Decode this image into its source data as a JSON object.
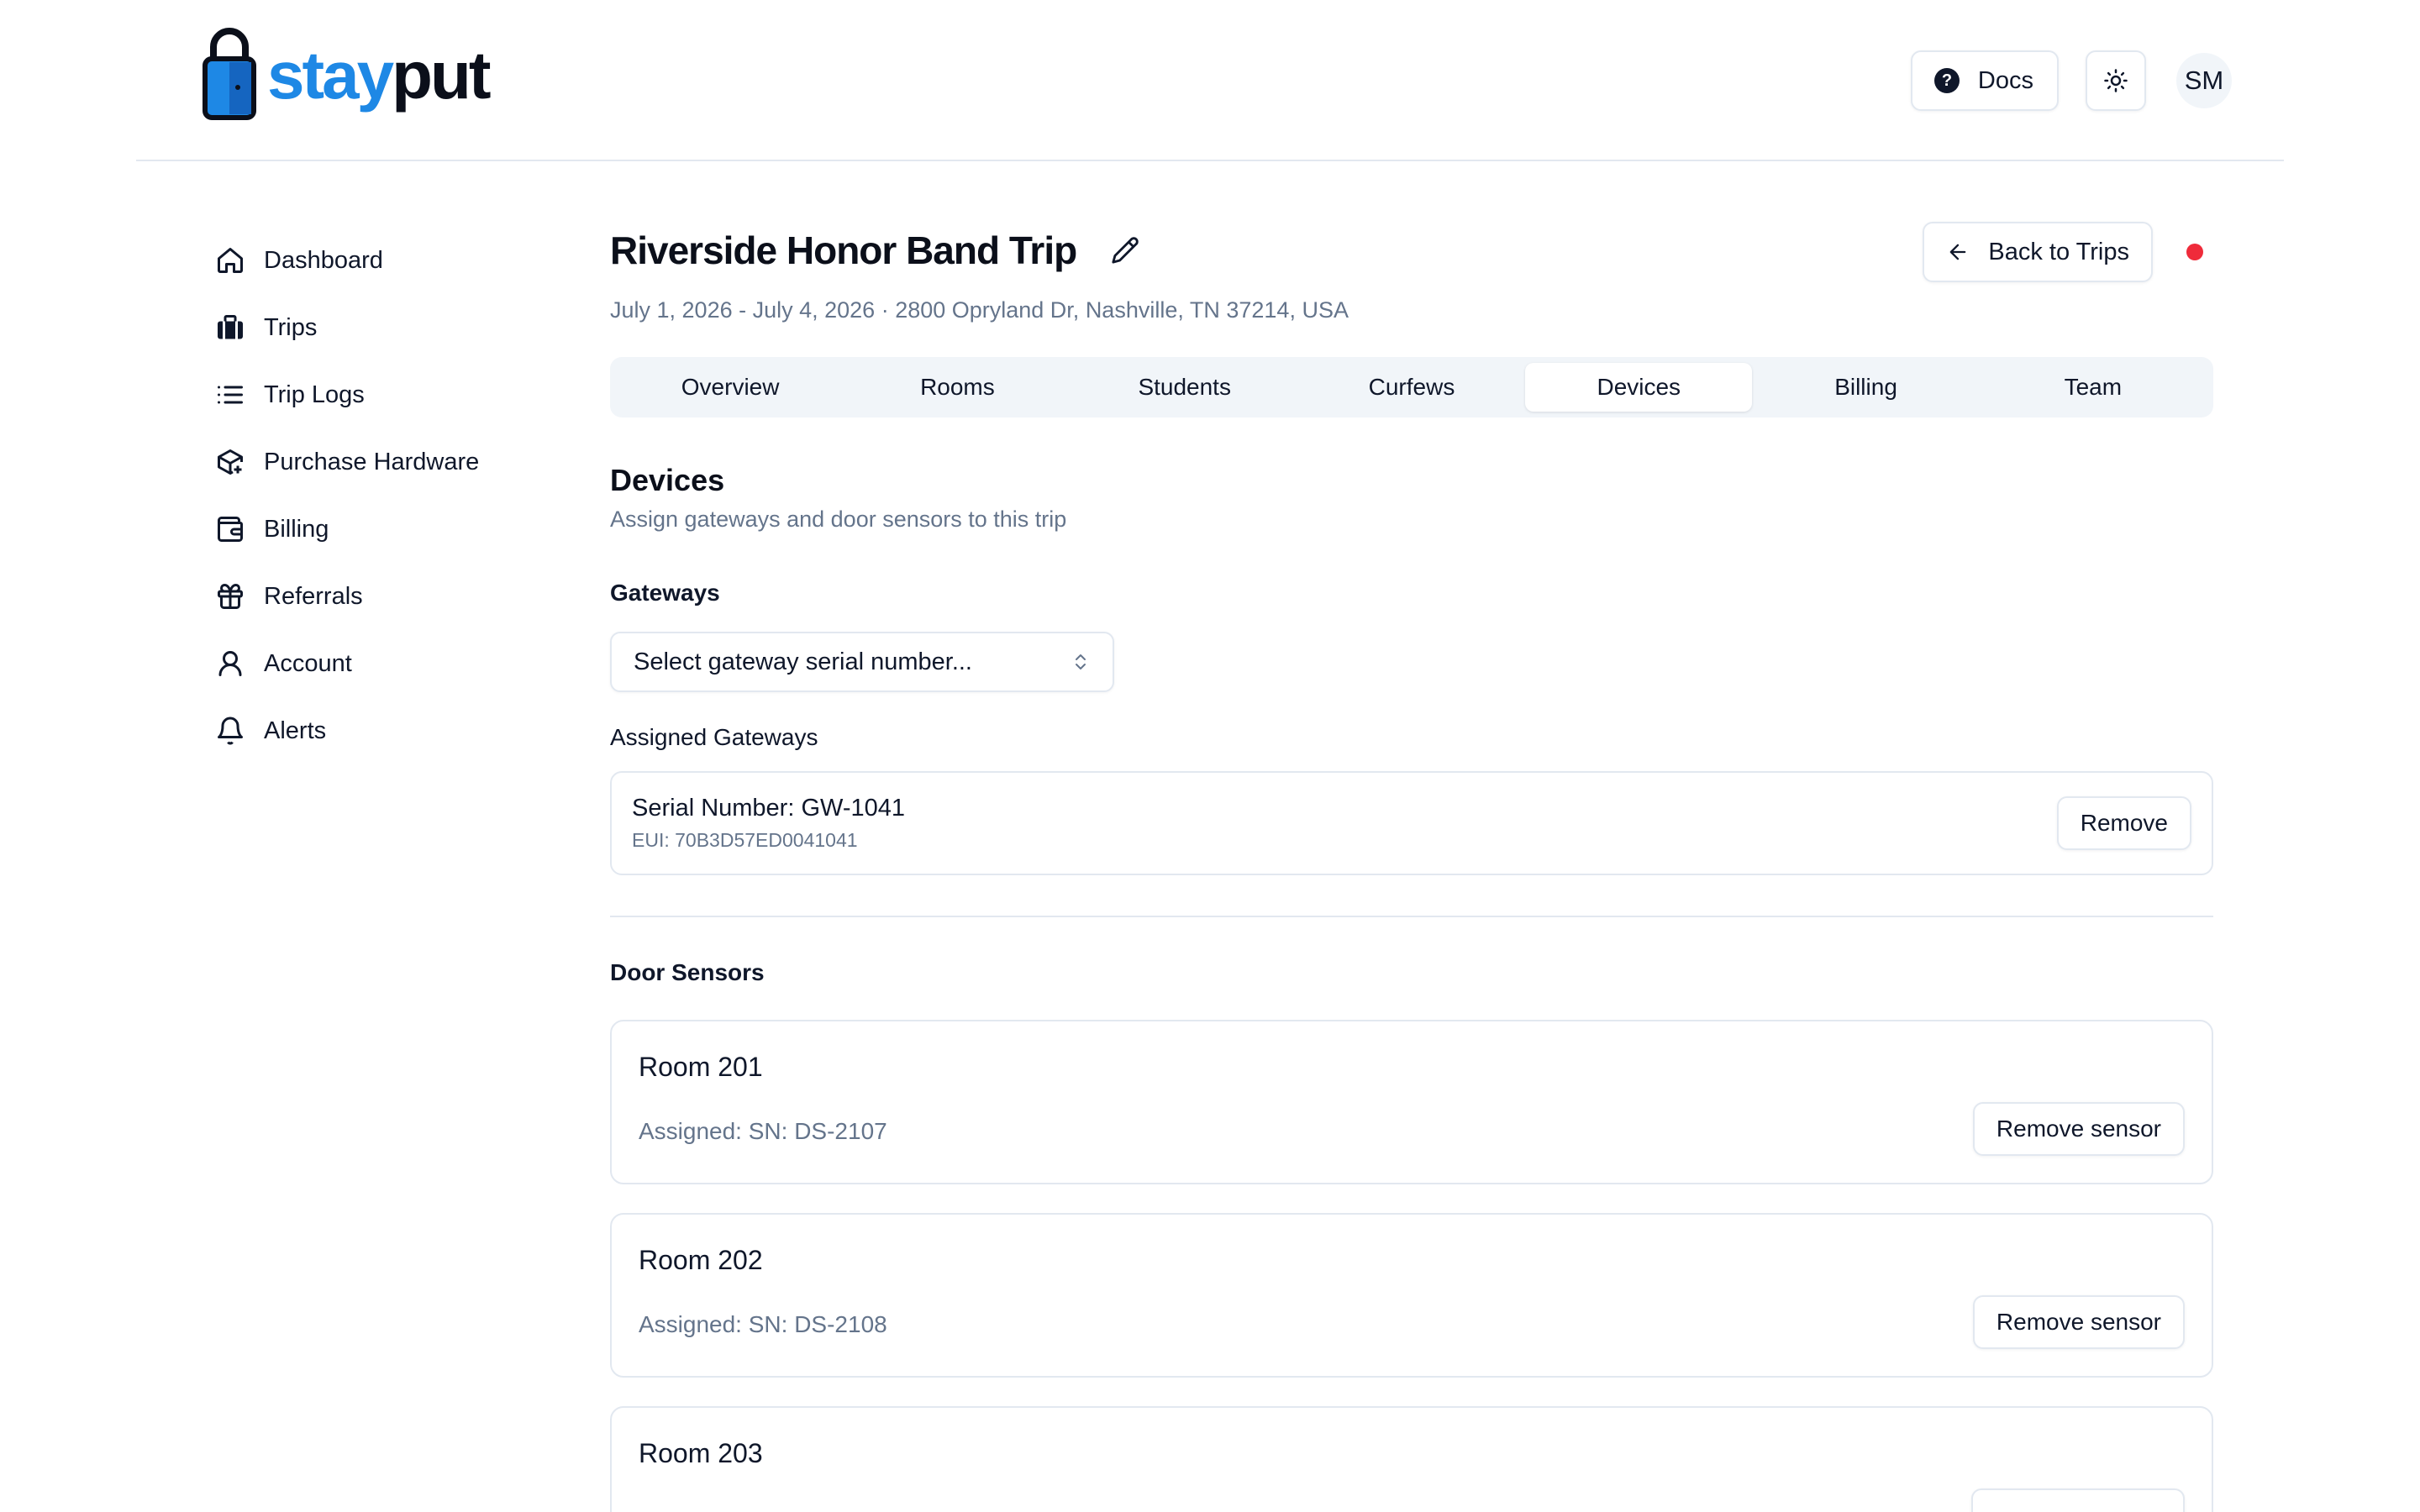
{
  "brand": {
    "name_part1": "stay",
    "name_part2": "put"
  },
  "header": {
    "docs_label": "Docs",
    "avatar_initials": "SM"
  },
  "sidebar": {
    "items": [
      {
        "label": "Dashboard",
        "icon": "home-icon"
      },
      {
        "label": "Trips",
        "icon": "luggage-icon"
      },
      {
        "label": "Trip Logs",
        "icon": "list-icon"
      },
      {
        "label": "Purchase Hardware",
        "icon": "package-plus-icon"
      },
      {
        "label": "Billing",
        "icon": "wallet-icon"
      },
      {
        "label": "Referrals",
        "icon": "gift-icon"
      },
      {
        "label": "Account",
        "icon": "user-icon"
      },
      {
        "label": "Alerts",
        "icon": "bell-icon"
      }
    ]
  },
  "trip": {
    "title": "Riverside Honor Band Trip",
    "subtitle": "July 1, 2026 - July 4, 2026 · 2800 Opryland Dr, Nashville, TN 37214, USA",
    "back_label": "Back to Trips",
    "status_color": "#ef2b3a"
  },
  "tabs": [
    {
      "label": "Overview",
      "active": false
    },
    {
      "label": "Rooms",
      "active": false
    },
    {
      "label": "Students",
      "active": false
    },
    {
      "label": "Curfews",
      "active": false
    },
    {
      "label": "Devices",
      "active": true
    },
    {
      "label": "Billing",
      "active": false
    },
    {
      "label": "Team",
      "active": false
    }
  ],
  "devices": {
    "title": "Devices",
    "subtitle": "Assign gateways and door sensors to this trip",
    "gateways_label": "Gateways",
    "select_placeholder": "Select gateway serial number...",
    "assigned_gateways_label": "Assigned Gateways",
    "assigned_gateways": [
      {
        "serial": "Serial Number: GW-1041",
        "eui": "EUI: 70B3D57ED0041041",
        "remove_label": "Remove"
      }
    ],
    "door_sensors_label": "Door Sensors",
    "rooms": [
      {
        "name": "Room 201",
        "assigned": "Assigned: SN: DS-2107",
        "remove_label": "Remove sensor"
      },
      {
        "name": "Room 202",
        "assigned": "Assigned: SN: DS-2108",
        "remove_label": "Remove sensor"
      },
      {
        "name": "Room 203",
        "assigned": "",
        "remove_label": ""
      }
    ]
  },
  "colors": {
    "accent": "#1e88e5",
    "muted_text": "#64748b",
    "border": "#e2e8f0"
  }
}
